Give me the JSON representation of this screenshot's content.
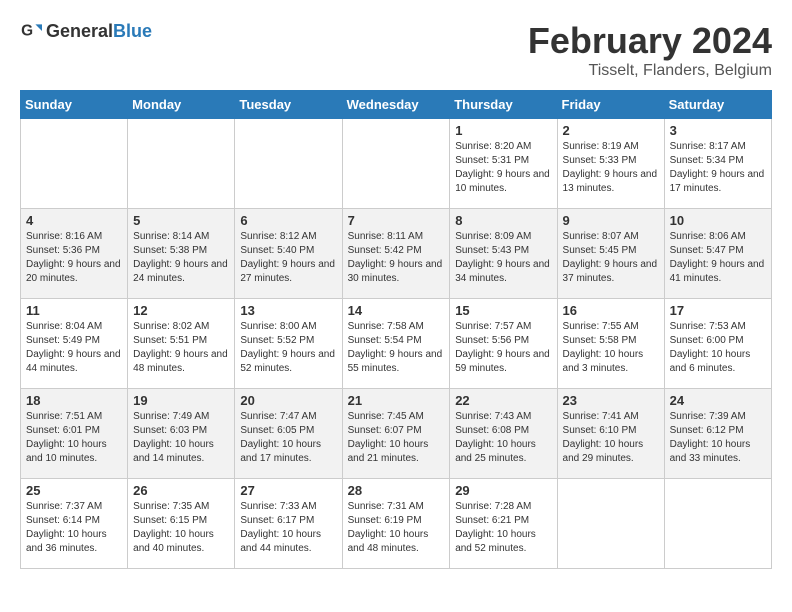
{
  "header": {
    "logo_general": "General",
    "logo_blue": "Blue",
    "main_title": "February 2024",
    "subtitle": "Tisselt, Flanders, Belgium"
  },
  "days_of_week": [
    "Sunday",
    "Monday",
    "Tuesday",
    "Wednesday",
    "Thursday",
    "Friday",
    "Saturday"
  ],
  "weeks": [
    [
      {
        "day": "",
        "info": ""
      },
      {
        "day": "",
        "info": ""
      },
      {
        "day": "",
        "info": ""
      },
      {
        "day": "",
        "info": ""
      },
      {
        "day": "1",
        "info": "Sunrise: 8:20 AM\nSunset: 5:31 PM\nDaylight: 9 hours\nand 10 minutes."
      },
      {
        "day": "2",
        "info": "Sunrise: 8:19 AM\nSunset: 5:33 PM\nDaylight: 9 hours\nand 13 minutes."
      },
      {
        "day": "3",
        "info": "Sunrise: 8:17 AM\nSunset: 5:34 PM\nDaylight: 9 hours\nand 17 minutes."
      }
    ],
    [
      {
        "day": "4",
        "info": "Sunrise: 8:16 AM\nSunset: 5:36 PM\nDaylight: 9 hours\nand 20 minutes."
      },
      {
        "day": "5",
        "info": "Sunrise: 8:14 AM\nSunset: 5:38 PM\nDaylight: 9 hours\nand 24 minutes."
      },
      {
        "day": "6",
        "info": "Sunrise: 8:12 AM\nSunset: 5:40 PM\nDaylight: 9 hours\nand 27 minutes."
      },
      {
        "day": "7",
        "info": "Sunrise: 8:11 AM\nSunset: 5:42 PM\nDaylight: 9 hours\nand 30 minutes."
      },
      {
        "day": "8",
        "info": "Sunrise: 8:09 AM\nSunset: 5:43 PM\nDaylight: 9 hours\nand 34 minutes."
      },
      {
        "day": "9",
        "info": "Sunrise: 8:07 AM\nSunset: 5:45 PM\nDaylight: 9 hours\nand 37 minutes."
      },
      {
        "day": "10",
        "info": "Sunrise: 8:06 AM\nSunset: 5:47 PM\nDaylight: 9 hours\nand 41 minutes."
      }
    ],
    [
      {
        "day": "11",
        "info": "Sunrise: 8:04 AM\nSunset: 5:49 PM\nDaylight: 9 hours\nand 44 minutes."
      },
      {
        "day": "12",
        "info": "Sunrise: 8:02 AM\nSunset: 5:51 PM\nDaylight: 9 hours\nand 48 minutes."
      },
      {
        "day": "13",
        "info": "Sunrise: 8:00 AM\nSunset: 5:52 PM\nDaylight: 9 hours\nand 52 minutes."
      },
      {
        "day": "14",
        "info": "Sunrise: 7:58 AM\nSunset: 5:54 PM\nDaylight: 9 hours\nand 55 minutes."
      },
      {
        "day": "15",
        "info": "Sunrise: 7:57 AM\nSunset: 5:56 PM\nDaylight: 9 hours\nand 59 minutes."
      },
      {
        "day": "16",
        "info": "Sunrise: 7:55 AM\nSunset: 5:58 PM\nDaylight: 10 hours\nand 3 minutes."
      },
      {
        "day": "17",
        "info": "Sunrise: 7:53 AM\nSunset: 6:00 PM\nDaylight: 10 hours\nand 6 minutes."
      }
    ],
    [
      {
        "day": "18",
        "info": "Sunrise: 7:51 AM\nSunset: 6:01 PM\nDaylight: 10 hours\nand 10 minutes."
      },
      {
        "day": "19",
        "info": "Sunrise: 7:49 AM\nSunset: 6:03 PM\nDaylight: 10 hours\nand 14 minutes."
      },
      {
        "day": "20",
        "info": "Sunrise: 7:47 AM\nSunset: 6:05 PM\nDaylight: 10 hours\nand 17 minutes."
      },
      {
        "day": "21",
        "info": "Sunrise: 7:45 AM\nSunset: 6:07 PM\nDaylight: 10 hours\nand 21 minutes."
      },
      {
        "day": "22",
        "info": "Sunrise: 7:43 AM\nSunset: 6:08 PM\nDaylight: 10 hours\nand 25 minutes."
      },
      {
        "day": "23",
        "info": "Sunrise: 7:41 AM\nSunset: 6:10 PM\nDaylight: 10 hours\nand 29 minutes."
      },
      {
        "day": "24",
        "info": "Sunrise: 7:39 AM\nSunset: 6:12 PM\nDaylight: 10 hours\nand 33 minutes."
      }
    ],
    [
      {
        "day": "25",
        "info": "Sunrise: 7:37 AM\nSunset: 6:14 PM\nDaylight: 10 hours\nand 36 minutes."
      },
      {
        "day": "26",
        "info": "Sunrise: 7:35 AM\nSunset: 6:15 PM\nDaylight: 10 hours\nand 40 minutes."
      },
      {
        "day": "27",
        "info": "Sunrise: 7:33 AM\nSunset: 6:17 PM\nDaylight: 10 hours\nand 44 minutes."
      },
      {
        "day": "28",
        "info": "Sunrise: 7:31 AM\nSunset: 6:19 PM\nDaylight: 10 hours\nand 48 minutes."
      },
      {
        "day": "29",
        "info": "Sunrise: 7:28 AM\nSunset: 6:21 PM\nDaylight: 10 hours\nand 52 minutes."
      },
      {
        "day": "",
        "info": ""
      },
      {
        "day": "",
        "info": ""
      }
    ]
  ]
}
